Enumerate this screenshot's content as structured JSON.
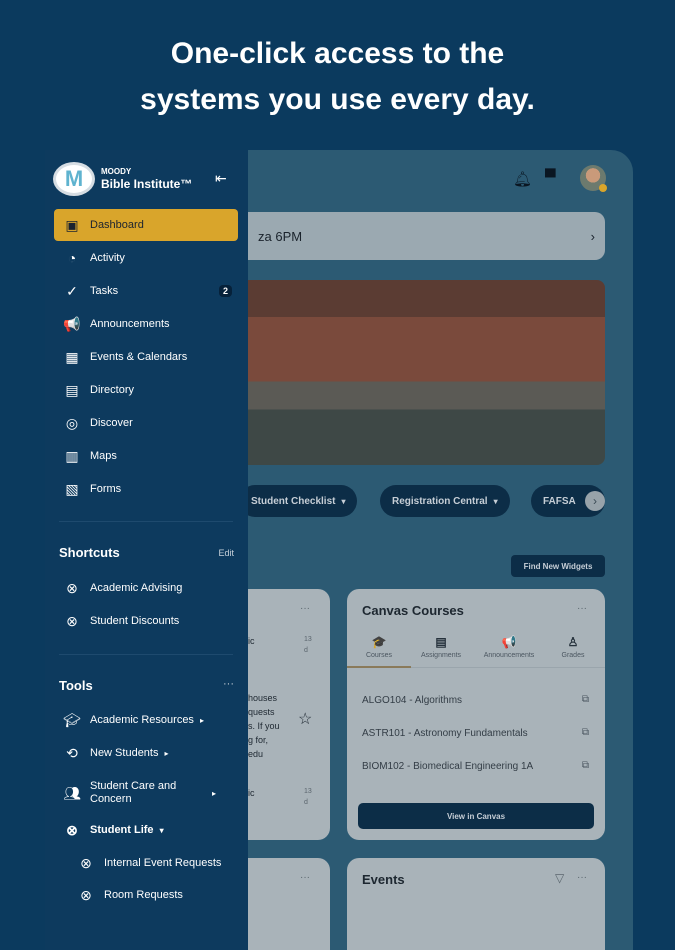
{
  "headline": {
    "line1": "One-click access to the",
    "line2": "systems you use every day."
  },
  "brand": {
    "line1": "MOODY",
    "line2": "Bible Institute™",
    "logo_letter": "M"
  },
  "nav": [
    {
      "label": "Dashboard",
      "icon": "dashboard-icon",
      "glyph": "▣"
    },
    {
      "label": "Activity",
      "icon": "rss-icon",
      "glyph": "◔"
    },
    {
      "label": "Tasks",
      "icon": "check-circle-icon",
      "glyph": "✓",
      "badge": "2"
    },
    {
      "label": "Announcements",
      "icon": "megaphone-icon",
      "glyph": "📢"
    },
    {
      "label": "Events & Calendars",
      "icon": "calendar-icon",
      "glyph": "▦"
    },
    {
      "label": "Directory",
      "icon": "directory-icon",
      "glyph": "▤"
    },
    {
      "label": "Discover",
      "icon": "compass-icon",
      "glyph": "◎"
    },
    {
      "label": "Maps",
      "icon": "map-icon",
      "glyph": "▥"
    },
    {
      "label": "Forms",
      "icon": "clipboard-icon",
      "glyph": "▧"
    }
  ],
  "shortcuts": {
    "title": "Shortcuts",
    "edit": "Edit",
    "items": [
      "Academic Advising",
      "Student Discounts"
    ]
  },
  "tools": {
    "title": "Tools",
    "more": "···",
    "items": [
      {
        "label": "Academic Resources",
        "arrow": "▸"
      },
      {
        "label": "New Students",
        "arrow": "▸"
      },
      {
        "label": "Student Care and Concern",
        "arrow": "▸"
      },
      {
        "label": "Student Life",
        "arrow": "▾"
      },
      {
        "label": "Internal Event Requests"
      },
      {
        "label": "Room Requests"
      }
    ]
  },
  "banner": {
    "text": "za 6PM",
    "chevron": "›"
  },
  "chips": [
    "Student Checklist",
    "Registration Central",
    "FAFSA"
  ],
  "chip_caret": "▾",
  "chip_next": "›",
  "find_widgets": "Find New Widgets",
  "left_card": {
    "more": "···",
    "lines": [
      "ic",
      "13",
      "d",
      "houses",
      "quests",
      "s. If you",
      "g for,",
      "edu",
      "ic",
      "13",
      "d"
    ]
  },
  "canvas": {
    "title": "Canvas Courses",
    "more": "···",
    "tabs": [
      {
        "label": "Courses",
        "glyph": "🎓"
      },
      {
        "label": "Assignments",
        "glyph": "▤"
      },
      {
        "label": "Announcements",
        "glyph": "📢"
      },
      {
        "label": "Grades",
        "glyph": "♙"
      }
    ],
    "courses": [
      "ALGO104 - Algorithms",
      "ASTR101 - Astronomy Fundamentals",
      "BIOM102 - Biomedical Engineering 1A"
    ],
    "button": "View in Canvas"
  },
  "events": {
    "title": "Events",
    "filter": "▽",
    "more": "···"
  },
  "colors": {
    "bg": "#0b3a5e",
    "accent": "#d9a52b",
    "sidebar": "#0d3a5e"
  }
}
